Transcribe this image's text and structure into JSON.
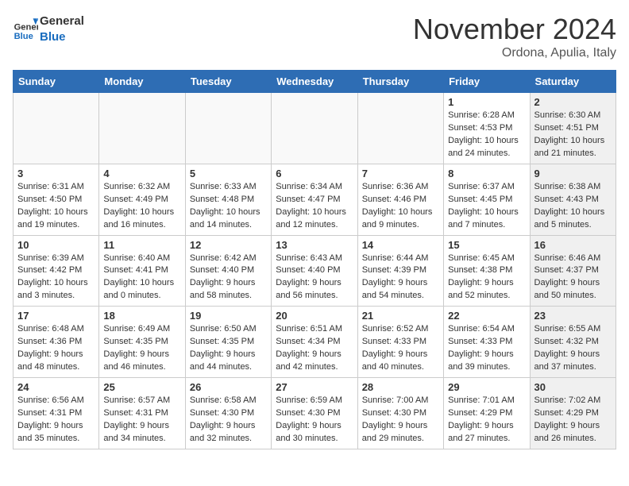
{
  "header": {
    "logo_general": "General",
    "logo_blue": "Blue",
    "month_title": "November 2024",
    "location": "Ordona, Apulia, Italy"
  },
  "days_of_week": [
    "Sunday",
    "Monday",
    "Tuesday",
    "Wednesday",
    "Thursday",
    "Friday",
    "Saturday"
  ],
  "weeks": [
    [
      {
        "day": "",
        "info": "",
        "empty": true
      },
      {
        "day": "",
        "info": "",
        "empty": true
      },
      {
        "day": "",
        "info": "",
        "empty": true
      },
      {
        "day": "",
        "info": "",
        "empty": true
      },
      {
        "day": "",
        "info": "",
        "empty": true
      },
      {
        "day": "1",
        "info": "Sunrise: 6:28 AM\nSunset: 4:53 PM\nDaylight: 10 hours\nand 24 minutes.",
        "shaded": false
      },
      {
        "day": "2",
        "info": "Sunrise: 6:30 AM\nSunset: 4:51 PM\nDaylight: 10 hours\nand 21 minutes.",
        "shaded": true
      }
    ],
    [
      {
        "day": "3",
        "info": "Sunrise: 6:31 AM\nSunset: 4:50 PM\nDaylight: 10 hours\nand 19 minutes.",
        "shaded": false
      },
      {
        "day": "4",
        "info": "Sunrise: 6:32 AM\nSunset: 4:49 PM\nDaylight: 10 hours\nand 16 minutes.",
        "shaded": false
      },
      {
        "day": "5",
        "info": "Sunrise: 6:33 AM\nSunset: 4:48 PM\nDaylight: 10 hours\nand 14 minutes.",
        "shaded": false
      },
      {
        "day": "6",
        "info": "Sunrise: 6:34 AM\nSunset: 4:47 PM\nDaylight: 10 hours\nand 12 minutes.",
        "shaded": false
      },
      {
        "day": "7",
        "info": "Sunrise: 6:36 AM\nSunset: 4:46 PM\nDaylight: 10 hours\nand 9 minutes.",
        "shaded": false
      },
      {
        "day": "8",
        "info": "Sunrise: 6:37 AM\nSunset: 4:45 PM\nDaylight: 10 hours\nand 7 minutes.",
        "shaded": false
      },
      {
        "day": "9",
        "info": "Sunrise: 6:38 AM\nSunset: 4:43 PM\nDaylight: 10 hours\nand 5 minutes.",
        "shaded": true
      }
    ],
    [
      {
        "day": "10",
        "info": "Sunrise: 6:39 AM\nSunset: 4:42 PM\nDaylight: 10 hours\nand 3 minutes.",
        "shaded": false
      },
      {
        "day": "11",
        "info": "Sunrise: 6:40 AM\nSunset: 4:41 PM\nDaylight: 10 hours\nand 0 minutes.",
        "shaded": false
      },
      {
        "day": "12",
        "info": "Sunrise: 6:42 AM\nSunset: 4:40 PM\nDaylight: 9 hours\nand 58 minutes.",
        "shaded": false
      },
      {
        "day": "13",
        "info": "Sunrise: 6:43 AM\nSunset: 4:40 PM\nDaylight: 9 hours\nand 56 minutes.",
        "shaded": false
      },
      {
        "day": "14",
        "info": "Sunrise: 6:44 AM\nSunset: 4:39 PM\nDaylight: 9 hours\nand 54 minutes.",
        "shaded": false
      },
      {
        "day": "15",
        "info": "Sunrise: 6:45 AM\nSunset: 4:38 PM\nDaylight: 9 hours\nand 52 minutes.",
        "shaded": false
      },
      {
        "day": "16",
        "info": "Sunrise: 6:46 AM\nSunset: 4:37 PM\nDaylight: 9 hours\nand 50 minutes.",
        "shaded": true
      }
    ],
    [
      {
        "day": "17",
        "info": "Sunrise: 6:48 AM\nSunset: 4:36 PM\nDaylight: 9 hours\nand 48 minutes.",
        "shaded": false
      },
      {
        "day": "18",
        "info": "Sunrise: 6:49 AM\nSunset: 4:35 PM\nDaylight: 9 hours\nand 46 minutes.",
        "shaded": false
      },
      {
        "day": "19",
        "info": "Sunrise: 6:50 AM\nSunset: 4:35 PM\nDaylight: 9 hours\nand 44 minutes.",
        "shaded": false
      },
      {
        "day": "20",
        "info": "Sunrise: 6:51 AM\nSunset: 4:34 PM\nDaylight: 9 hours\nand 42 minutes.",
        "shaded": false
      },
      {
        "day": "21",
        "info": "Sunrise: 6:52 AM\nSunset: 4:33 PM\nDaylight: 9 hours\nand 40 minutes.",
        "shaded": false
      },
      {
        "day": "22",
        "info": "Sunrise: 6:54 AM\nSunset: 4:33 PM\nDaylight: 9 hours\nand 39 minutes.",
        "shaded": false
      },
      {
        "day": "23",
        "info": "Sunrise: 6:55 AM\nSunset: 4:32 PM\nDaylight: 9 hours\nand 37 minutes.",
        "shaded": true
      }
    ],
    [
      {
        "day": "24",
        "info": "Sunrise: 6:56 AM\nSunset: 4:31 PM\nDaylight: 9 hours\nand 35 minutes.",
        "shaded": false
      },
      {
        "day": "25",
        "info": "Sunrise: 6:57 AM\nSunset: 4:31 PM\nDaylight: 9 hours\nand 34 minutes.",
        "shaded": false
      },
      {
        "day": "26",
        "info": "Sunrise: 6:58 AM\nSunset: 4:30 PM\nDaylight: 9 hours\nand 32 minutes.",
        "shaded": false
      },
      {
        "day": "27",
        "info": "Sunrise: 6:59 AM\nSunset: 4:30 PM\nDaylight: 9 hours\nand 30 minutes.",
        "shaded": false
      },
      {
        "day": "28",
        "info": "Sunrise: 7:00 AM\nSunset: 4:30 PM\nDaylight: 9 hours\nand 29 minutes.",
        "shaded": false
      },
      {
        "day": "29",
        "info": "Sunrise: 7:01 AM\nSunset: 4:29 PM\nDaylight: 9 hours\nand 27 minutes.",
        "shaded": false
      },
      {
        "day": "30",
        "info": "Sunrise: 7:02 AM\nSunset: 4:29 PM\nDaylight: 9 hours\nand 26 minutes.",
        "shaded": true
      }
    ]
  ]
}
